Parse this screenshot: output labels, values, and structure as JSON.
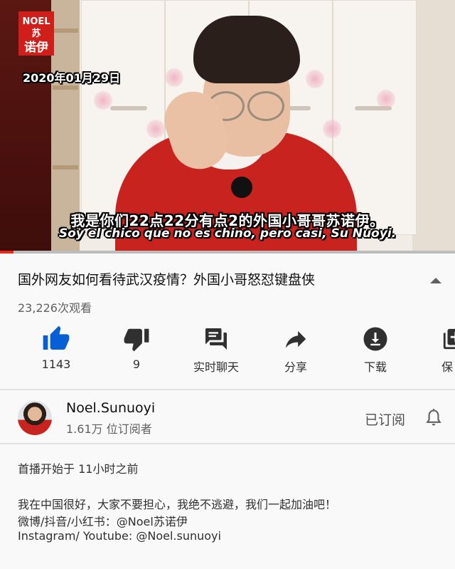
{
  "video": {
    "logo_line1": "NOEL苏",
    "logo_line2": "诺伊",
    "date_overlay": "2020年01月29日",
    "subtitle_cn": "我是你们22点22分有点2的外国小哥哥苏诺伊。",
    "subtitle_es": "Soy el chico que no es chino, pero casi, Su Nuoyi.",
    "progress_fraction": 0.03
  },
  "info": {
    "title": "国外网友如何看待武汉疫情？外国小哥怒怼键盘侠",
    "views": "23,226次观看"
  },
  "actions": [
    {
      "icon": "thumbs-up-icon",
      "label": "1143",
      "color": "#065fd4"
    },
    {
      "icon": "thumbs-down-icon",
      "label": "9",
      "color": "#303030"
    },
    {
      "icon": "live-chat-icon",
      "label": "实时聊天",
      "color": "#303030"
    },
    {
      "icon": "share-icon",
      "label": "分享",
      "color": "#303030"
    },
    {
      "icon": "download-icon",
      "label": "下载",
      "color": "#303030"
    },
    {
      "icon": "save-icon",
      "label": "保",
      "color": "#303030"
    }
  ],
  "channel": {
    "name": "Noel.Sunuoyi",
    "subscribers": "1.61万 位订阅者",
    "subscribe_state": "已订阅"
  },
  "description": {
    "premiere": "首播开始于 11小时之前",
    "lines": [
      "我在中国很好，大家不要担心，我绝不逃避，我们一起加油吧！",
      "微博/抖音/小红书：@Noel苏诺伊",
      "Instagram/ Youtube: @Noel.sunuoyi"
    ]
  },
  "colors": {
    "accent": "#065fd4",
    "progress": "#e5291f",
    "brand_red": "#d01f1b"
  }
}
